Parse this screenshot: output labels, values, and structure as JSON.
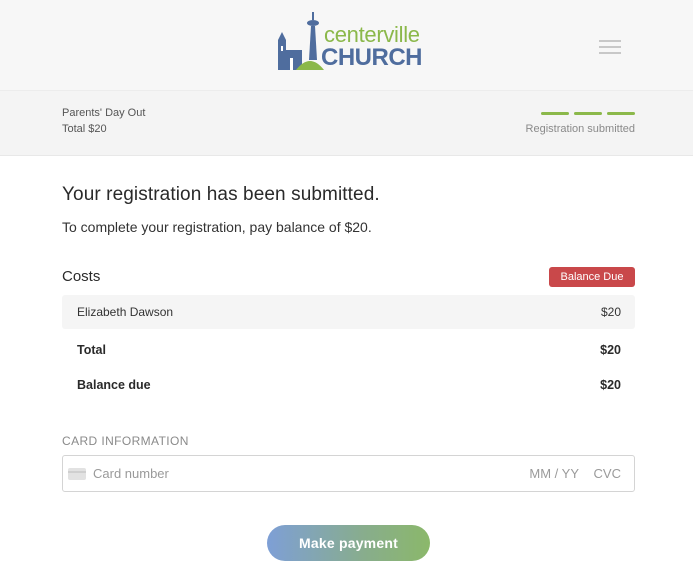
{
  "header": {
    "logo": {
      "line1": "centerville",
      "line2": "CHURCH",
      "colors": {
        "green": "#8bb84a",
        "blue": "#4f6d9e"
      }
    },
    "menu_icon": "hamburger-menu-icon"
  },
  "summary": {
    "event_name": "Parents' Day Out",
    "total": "Total $20",
    "progress_steps_completed": 3,
    "progress_steps_total": 3,
    "status": "Registration submitted"
  },
  "main": {
    "heading": "Your registration has been submitted.",
    "subtext": "To complete your registration, pay balance of $20.",
    "costs": {
      "title": "Costs",
      "badge": "Balance Due",
      "badge_color": "#c9484a",
      "items": [
        {
          "name": "Elizabeth Dawson",
          "amount": "$20"
        }
      ],
      "total_label": "Total",
      "total_value": "$20",
      "balance_label": "Balance due",
      "balance_value": "$20"
    },
    "card": {
      "label": "CARD INFORMATION",
      "number_placeholder": "Card number",
      "expiry_placeholder": "MM / YY",
      "cvc_placeholder": "CVC",
      "icon": "credit-card-icon"
    },
    "pay_button": "Make payment"
  }
}
